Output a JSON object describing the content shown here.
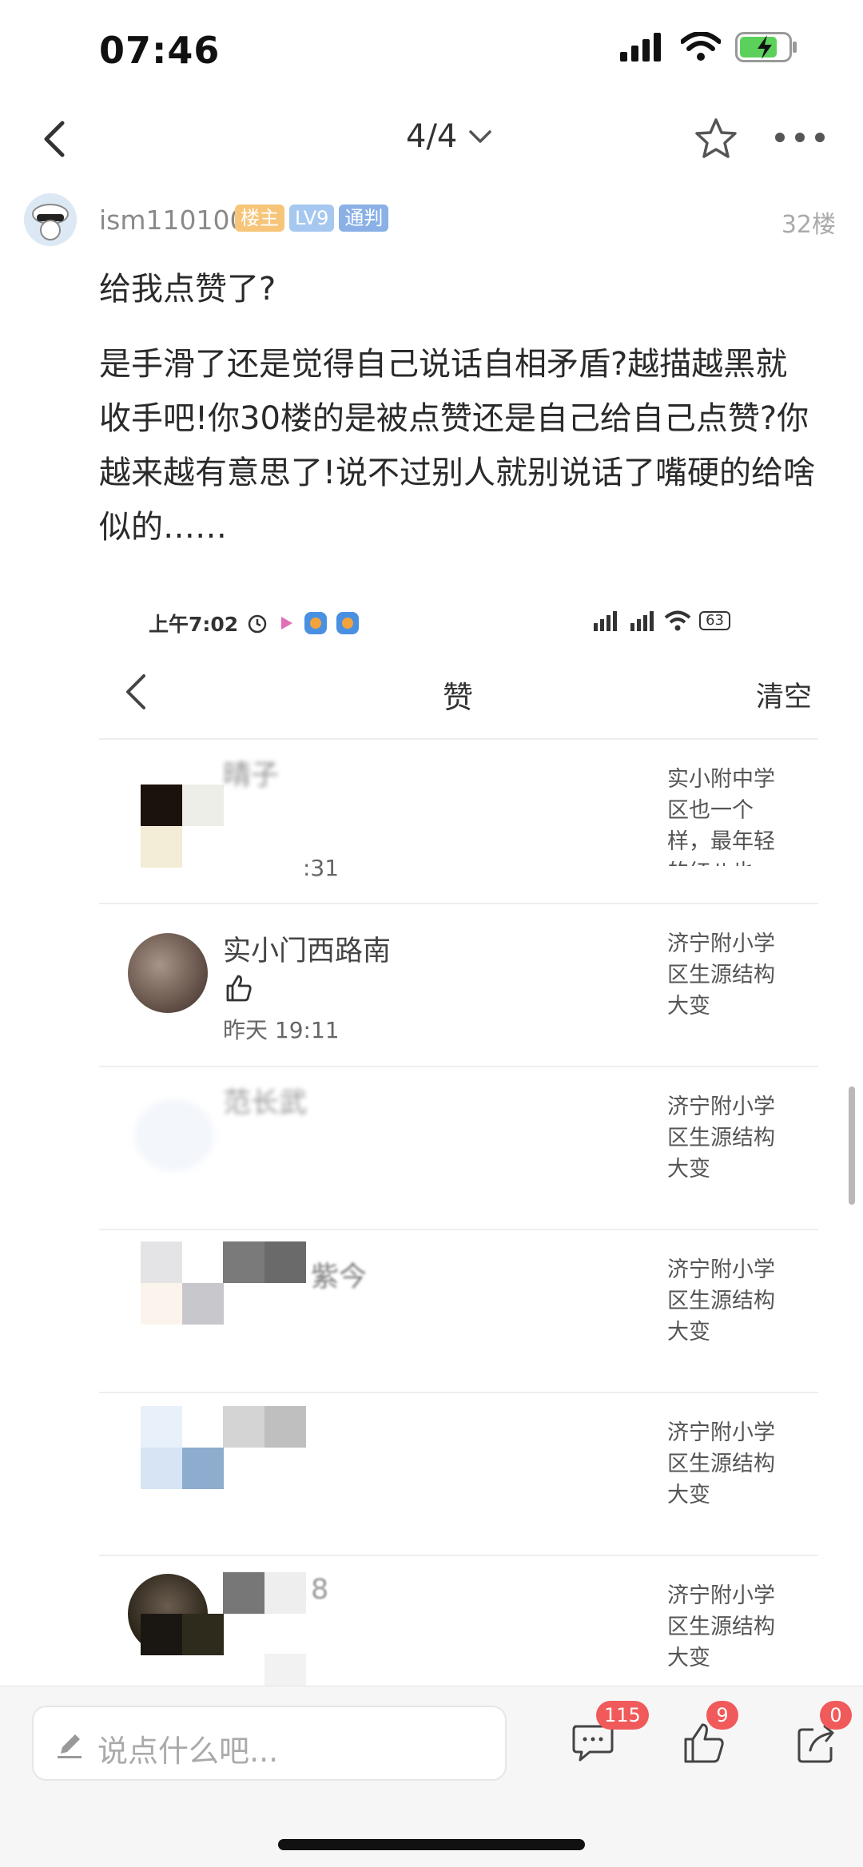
{
  "status_bar": {
    "time": "07:46",
    "battery_color": "#5bd15b"
  },
  "nav": {
    "pager": "4/4"
  },
  "post": {
    "username": "ism110100",
    "badges": {
      "owner": "楼主",
      "level": "LV9",
      "title": "通判"
    },
    "floor": "32楼",
    "paragraph1": "给我点赞了?",
    "paragraph2": "是手滑了还是觉得自己说话自相矛盾?越描越黑就收手吧!你30楼的是被点赞还是自己给自己点赞?你越来越有意思了!说不过别人就别说话了嘴硬的给啥似的……"
  },
  "screenshot": {
    "status_time": "上午7:02",
    "battery": "63",
    "title": "赞",
    "clear": "清空",
    "rows": [
      {
        "name": "晴子",
        "time": ":31",
        "right": "实小附中学区也一个样，最年轻的红八也"
      },
      {
        "name": "实小门西路南",
        "time": "昨天 19:11",
        "right": "济宁附小学区生源结构大变"
      },
      {
        "name": "范长武",
        "time": "",
        "right": "济宁附小学区生源结构大变"
      },
      {
        "name": "紫今",
        "time": "",
        "right": "济宁附小学区生源结构大变"
      },
      {
        "name": "",
        "time": "",
        "right": "济宁附小学区生源结构大变"
      },
      {
        "name": "8",
        "time": "",
        "right": "济宁附小学区生源结构大变"
      }
    ]
  },
  "bottom_bar": {
    "comment_placeholder": "说点什么吧...",
    "comments_count": "115",
    "likes_count": "9",
    "shares_count": "0",
    "badge_color": "#f05a5a"
  }
}
